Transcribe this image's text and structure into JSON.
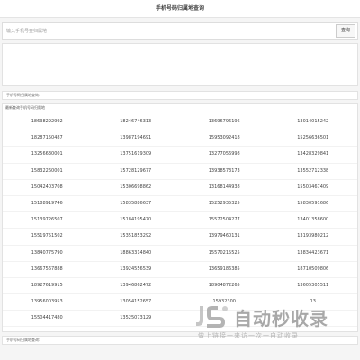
{
  "header": {
    "title": "手机号码归属地查询"
  },
  "search": {
    "placeholder": "输入手机号查归属地",
    "button_label": "查询"
  },
  "info_label_top": "手机号码归属地查询:",
  "recent": {
    "title": "最新查询手机号码归属地",
    "rows": [
      [
        "18638292992",
        "18246746313",
        "13696796196",
        "13014015242"
      ],
      [
        "18287150487",
        "13987194691",
        "15953092418",
        "15256636501"
      ],
      [
        "13256630001",
        "13751619309",
        "13277056998",
        "13428329841"
      ],
      [
        "15832260001",
        "15728129677",
        "13938573173",
        "13552712338"
      ],
      [
        "15042403708",
        "15306698862",
        "13168144938",
        "15503467409"
      ],
      [
        "15188919746",
        "15835886637",
        "15252935325",
        "15830591686"
      ],
      [
        "15139726507",
        "15184195470",
        "15572504277",
        "13401358600"
      ],
      [
        "15519751502",
        "15351853292",
        "13979460131",
        "13193980212"
      ],
      [
        "13840775790",
        "18863314840",
        "15570215525",
        "13834423671"
      ],
      [
        "13667567888",
        "13924556539",
        "13659186385",
        "18710509806"
      ],
      [
        "18927619915",
        "13946862472",
        "18904872265",
        "13605305511"
      ],
      [
        "13956003953",
        "13054152657",
        "15932300",
        "13"
      ],
      [
        "15504417480",
        "13525073129",
        "",
        ""
      ]
    ]
  },
  "info_label_bottom": "手机号码归属地查询:",
  "watermark": {
    "main": "自动秒收录",
    "sub": "做上链接一来访一次一自动收录"
  }
}
